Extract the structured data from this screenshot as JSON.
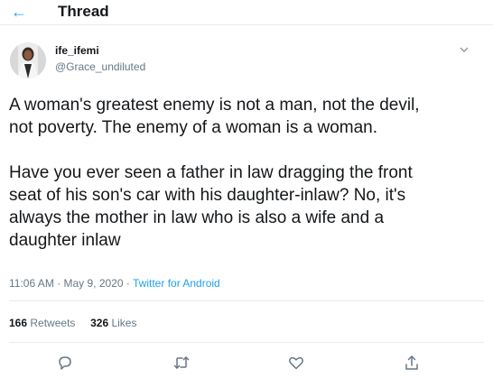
{
  "header": {
    "title": "Thread",
    "back_icon": "arrow-left-icon"
  },
  "user": {
    "display_name": "ife_ifemi",
    "handle": "@Grace_undiluted"
  },
  "tweet": {
    "text": "A woman's greatest enemy is not a man, not the devil,\nnot poverty. The enemy of a woman is a woman.\n\nHave you ever seen a father in law dragging the front\nseat of his son's car with his daughter-inlaw? No, it's\nalways the mother in law who is also a wife and a\ndaughter inlaw"
  },
  "meta": {
    "time": "11:06 AM",
    "date": "May 9, 2020",
    "separator": "·",
    "source": "Twitter for Android"
  },
  "stats": {
    "retweets_count": "166",
    "retweets_label": "Retweets",
    "likes_count": "326",
    "likes_label": "Likes"
  },
  "actions": [
    "reply-icon",
    "retweet-icon",
    "like-icon",
    "share-icon"
  ],
  "colors": {
    "accent": "#1da1f2",
    "secondary_text": "#657786",
    "primary_text": "#14171a",
    "divider": "#e6ecf0"
  }
}
